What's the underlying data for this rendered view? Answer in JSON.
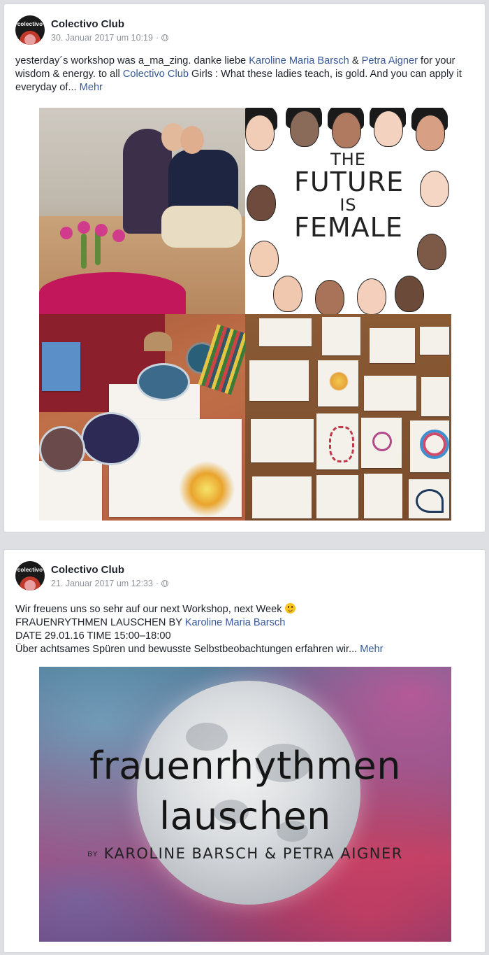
{
  "posts": [
    {
      "page_name": "Colectivo Club",
      "avatar_text": "colectivo",
      "date": "30. Januar 2017 um 10:19",
      "separator": "·",
      "text_parts": {
        "t1": "yesterday´s workshop was a_ma_zing. danke liebe ",
        "link1": "Karoline Maria Barsch",
        "t2": " & ",
        "link2": "Petra Aigner",
        "t3": " for your wisdom & energy. to all ",
        "link3": "Colectivo Club",
        "t4": " Girls : What these ladies teach, is gold. And you can apply it everyday of...",
        "more": "Mehr"
      },
      "image": {
        "poster_line1": "THE",
        "poster_line2": "FUTURE",
        "poster_line3": "IS",
        "poster_line4": "FEMALE"
      }
    },
    {
      "page_name": "Colectivo Club",
      "avatar_text": "colectivo",
      "date": "21. Januar 2017 um 12:33",
      "separator": "·",
      "text_lines": {
        "line1": "Wir freuens uns so sehr auf our next Workshop, next Week",
        "line2_prefix": "FRAUENRYTHMEN LAUSCHEN BY ",
        "line2_link": "Karoline Maria Barsch",
        "line3": "DATE 29.01.16 TIME 15:00–18:00",
        "line4": "Über achtsames Spüren und bewusste Selbstbeobachtungen erfahren wir...",
        "more": "Mehr"
      },
      "image": {
        "title_line1": "frauenrhythmen",
        "title_line2": "lauschen",
        "by": "BY",
        "authors": "KAROLINE BARSCH & PETRA AIGNER"
      }
    }
  ],
  "icons": {
    "globe": "globe-icon",
    "emoji": "smile-emoji-icon"
  },
  "colors": {
    "link": "#365899",
    "meta": "#90949c",
    "background": "#dddfe2"
  }
}
